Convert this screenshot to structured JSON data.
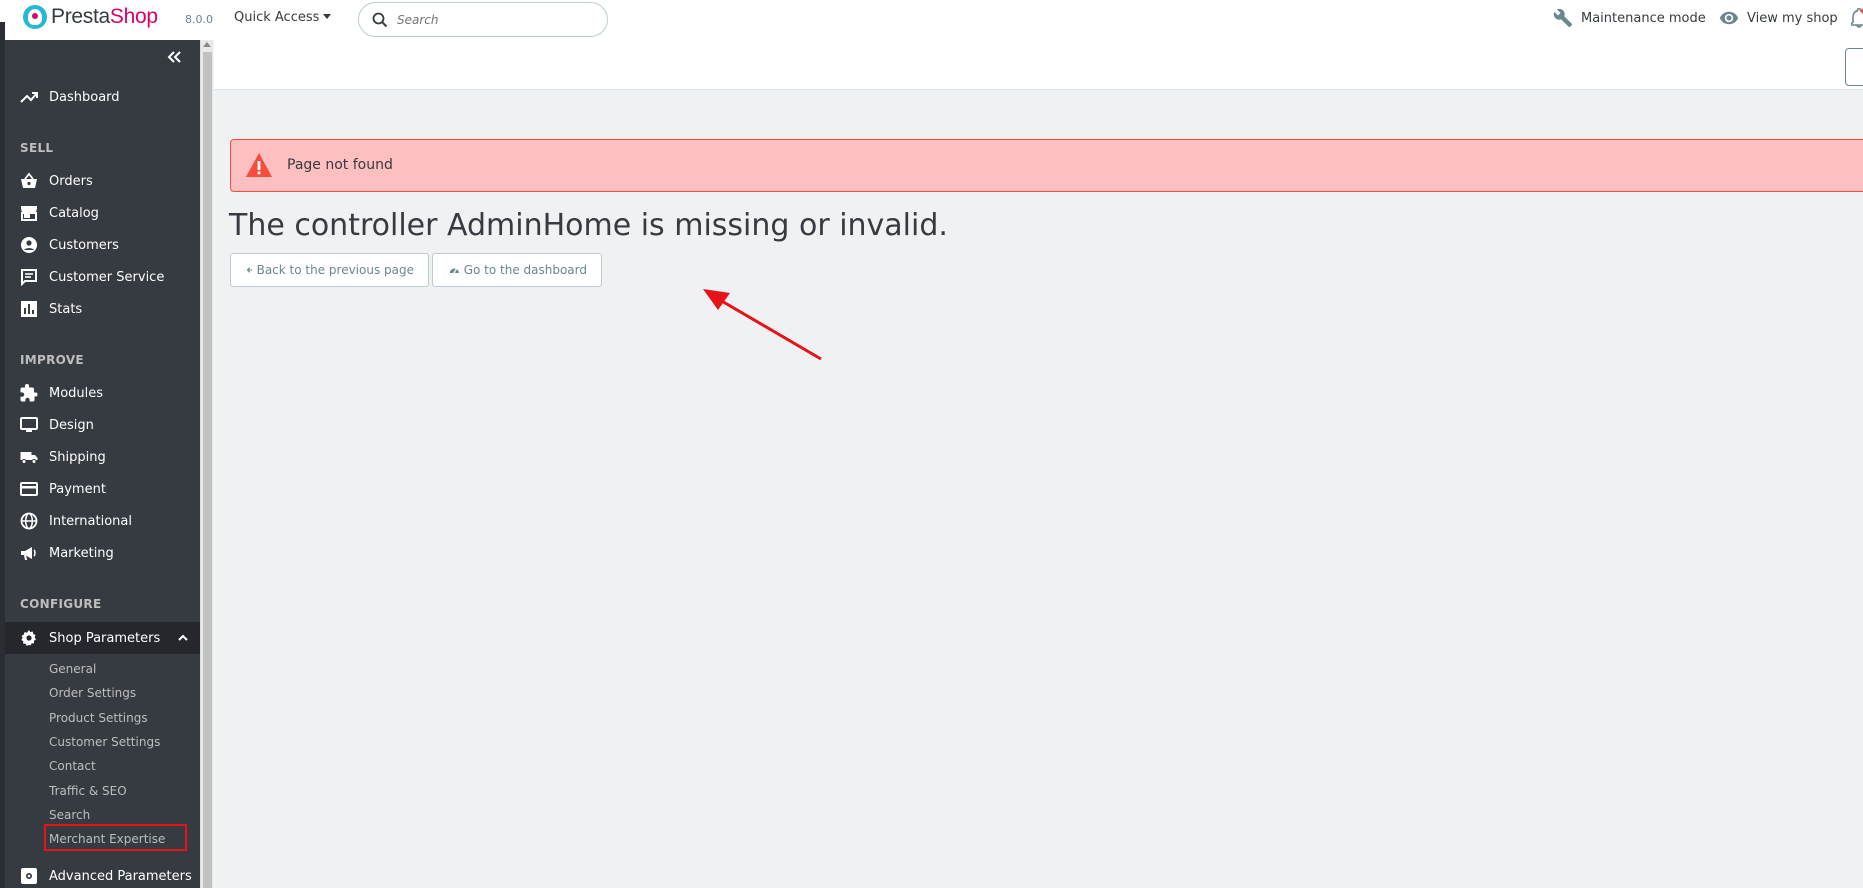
{
  "app": {
    "brand_presta": "Presta",
    "brand_shop": "Shop",
    "version": "8.0.0"
  },
  "topbar": {
    "quick_access": "Quick Access",
    "search_placeholder": "Search",
    "maintenance_label": "Maintenance mode",
    "view_shop_label": "View my shop"
  },
  "sidebar": {
    "dashboard": "Dashboard",
    "sections": {
      "sell": "SELL",
      "improve": "IMPROVE",
      "configure": "CONFIGURE"
    },
    "sell_items": [
      "Orders",
      "Catalog",
      "Customers",
      "Customer Service",
      "Stats"
    ],
    "improve_items": [
      "Modules",
      "Design",
      "Shipping",
      "Payment",
      "International",
      "Marketing"
    ],
    "configure": {
      "shop_parameters": "Shop Parameters",
      "sub_items": [
        "General",
        "Order Settings",
        "Product Settings",
        "Customer Settings",
        "Contact",
        "Traffic & SEO",
        "Search",
        "Merchant Expertise"
      ],
      "advanced_parameters": "Advanced Parameters"
    }
  },
  "content": {
    "alert_text": "Page not found",
    "error_title": "The controller AdminHome is missing or invalid.",
    "back_button": "Back to the previous page",
    "dashboard_button": "Go to the dashboard"
  },
  "colors": {
    "accent": "#25b9d7",
    "brand_pink": "#df0067",
    "sidebar_bg": "#363a41",
    "alert_bg": "#fdbfbf",
    "alert_border": "#f54c3e",
    "highlight_box": "#e6131a",
    "annotation_arrow": "#e6131a"
  },
  "icons": {
    "dashboard": "trending-up-icon",
    "orders": "basket-icon",
    "catalog": "store-icon",
    "customers": "account-circle-icon",
    "customer_service": "chat-icon",
    "stats": "bar-chart-icon",
    "modules": "puzzle-icon",
    "design": "desktop-icon",
    "shipping": "truck-icon",
    "payment": "credit-card-icon",
    "international": "globe-icon",
    "marketing": "megaphone-icon",
    "shop_parameters": "gear-icon",
    "advanced_parameters": "settings-applications-icon"
  }
}
